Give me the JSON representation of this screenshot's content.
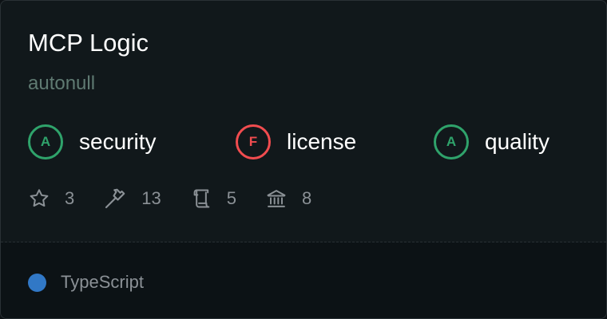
{
  "card": {
    "title": "MCP Logic",
    "author": "autonull",
    "grades": [
      {
        "letter": "A",
        "label": "security",
        "color": "#2fa36b"
      },
      {
        "letter": "F",
        "label": "license",
        "color": "#f14c4f"
      },
      {
        "letter": "A",
        "label": "quality",
        "color": "#2fa36b"
      }
    ],
    "stats": [
      {
        "icon": "star-icon",
        "value": "3"
      },
      {
        "icon": "hammer-icon",
        "value": "13"
      },
      {
        "icon": "scroll-icon",
        "value": "5"
      },
      {
        "icon": "bank-icon",
        "value": "8"
      }
    ],
    "language": {
      "name": "TypeScript",
      "color": "#3178c6"
    }
  }
}
